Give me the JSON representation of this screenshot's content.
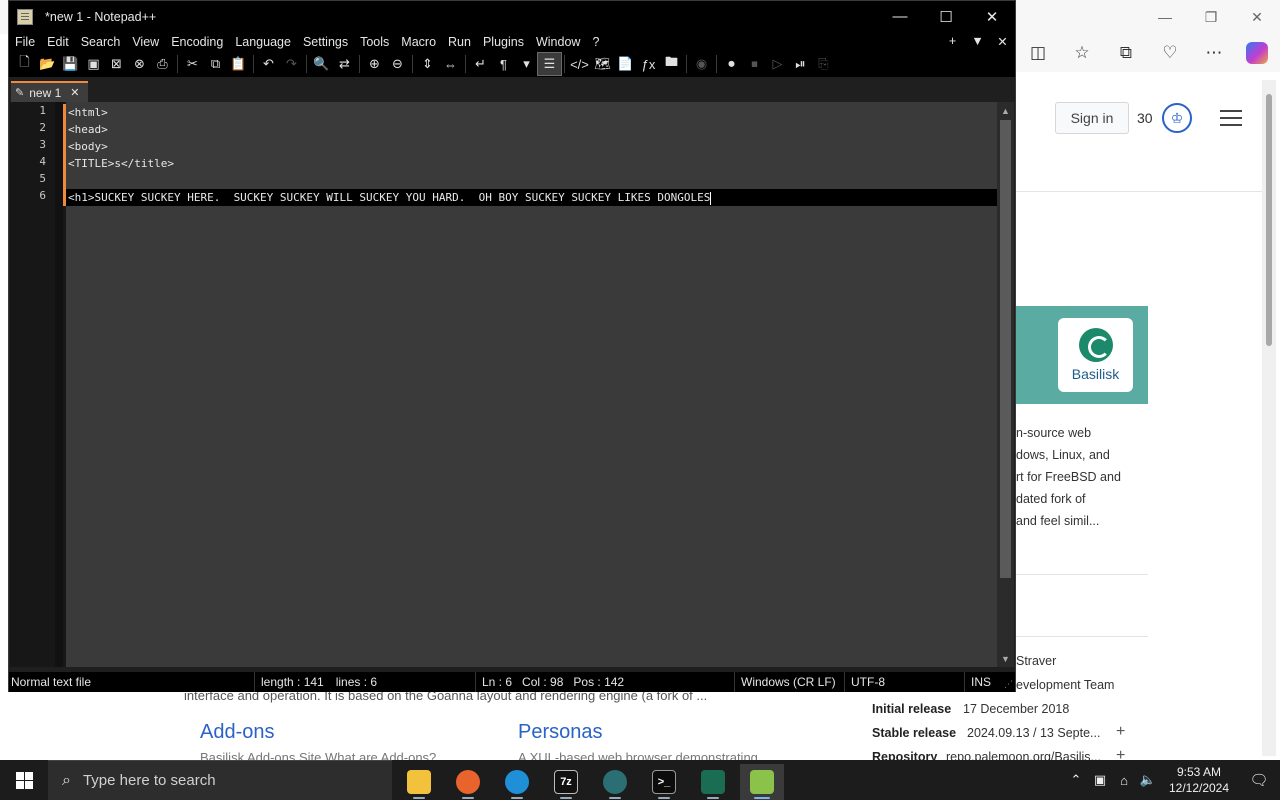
{
  "browser": {
    "signin_label": "Sign in",
    "score": "30",
    "logo_text": "Basilisk",
    "description_lines": [
      "n-source web",
      "dows, Linux, and",
      "rt for FreeBSD and",
      "dated fork of",
      "and feel simil..."
    ],
    "info_partial_1": "Straver",
    "info_partial_2": "evelopment Team",
    "initial_release_key": "Initial release",
    "initial_release_value": "17 December 2018",
    "stable_release_key": "Stable release",
    "stable_release_value": "2024.09.13 / 13 Septe...",
    "repository_key": "Repository",
    "repository_value": "repo.palemoon.org/Basilis...",
    "intro_text": "interface and operation. It is based on the Goanna layout and rendering engine (a fork of ...",
    "addons_heading": "Add-ons",
    "addons_sub": "Basilisk Add-ons Site What are Add-ons?",
    "personas_heading": "Personas",
    "personas_sub": "A XUL-based web browser demonstrating..."
  },
  "npp": {
    "window_title": "*new 1 - Notepad++",
    "menu": [
      "File",
      "Edit",
      "Search",
      "View",
      "Encoding",
      "Language",
      "Settings",
      "Tools",
      "Macro",
      "Run",
      "Plugins",
      "Window",
      "?"
    ],
    "menu_right": [
      "+",
      "▼",
      "✕"
    ],
    "tab_label": "new 1",
    "lines": [
      {
        "num": "1",
        "text": "<html>"
      },
      {
        "num": "2",
        "text": "<head>"
      },
      {
        "num": "3",
        "text": "<body>"
      },
      {
        "num": "4",
        "text": "<TITLE>s</title>"
      },
      {
        "num": "5",
        "text": ""
      },
      {
        "num": "6",
        "text": "<h1>SUCKEY SUCKEY HERE.  SUCKEY SUCKEY WILL SUCKEY YOU HARD.  OH BOY SUCKEY SUCKEY LIKES DONGOLES"
      }
    ],
    "status": {
      "file_type": "Normal text file",
      "length": "length : 141",
      "lines": "lines : 6",
      "ln": "Ln : 6",
      "col": "Col : 98",
      "pos": "Pos : 142",
      "eol": "Windows (CR LF)",
      "encoding": "UTF-8",
      "mode": "INS"
    }
  },
  "taskbar": {
    "search_placeholder": "Type here to search",
    "time": "9:53 AM",
    "date": "12/12/2024",
    "apps": [
      "file-explorer",
      "firefox",
      "edge",
      "7zip",
      "terminal-app",
      "command-prompt",
      "wireshark",
      "notepad-plus-plus"
    ]
  },
  "colors": {
    "accent_tab": "#f08a38",
    "teal_banner": "#5aaca3",
    "link_blue": "#2a62c8"
  }
}
